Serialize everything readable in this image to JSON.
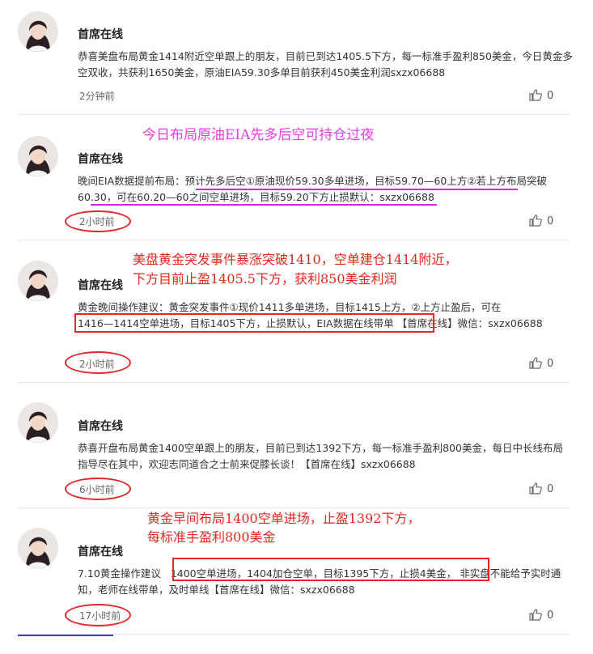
{
  "author_name": "首席在线",
  "colors": {
    "annotation_red": "#e0262a",
    "annotation_magenta": "#e040e0",
    "underline_blue": "#3b3bd6"
  },
  "posts": [
    {
      "text": "恭喜美盘布局黄金1414附近空单跟上的朋友，目前已到达1405.5下方，每一标准手盈利850美金，今日黄金多空双收，共获利1650美金，原油EIA59.30多单目前获利450美金利润sxzx06688",
      "time": "2分钟前",
      "likes": "0"
    },
    {
      "text": "晚间EIA数据提前布局：预计先多后空①原油现价59.30多单进场，目标59.70—60上方②若上方布局突破60.30，可在60.20—60之间空单进场，目标59.20下方止损默认：sxzx06688",
      "time": "2小时前",
      "likes": "0"
    },
    {
      "text_a": "黄金晚间操作建议：黄金突发事件①现价1411多单进场，目标1415上方，②上方止盈后，可在",
      "text_b_boxed": "1416—1414空单进场，目标1405下方，止损默认，EIA数据在线带单",
      "text_c": "【首席在线】微信：sxzx06688",
      "time": "2小时前",
      "likes": "0"
    },
    {
      "text": "恭喜开盘布局黄金1400空单跟上的朋友，目前已到达1392下方，每一标准手盈利800美金，每日中长线布局指导尽在其中，欢迎志同道合之士前来促膝长谈！【首席在线】sxzx06688",
      "time": "6小时前",
      "likes": "0"
    },
    {
      "text_a": "7.10黄金操作建议",
      "text_b_boxed": "1400空单进场，1404加仓空单，目标1395下方，止损4美金，",
      "text_c": "非实盘不能给予实时通知，老师在线带单，及时单线【首席在线】微信：sxzx06688",
      "time": "17小时前",
      "likes": "0"
    }
  ],
  "annotations": {
    "a1": "今日布局原油EIA先多后空可持仓过夜",
    "a2_line1": "美盘黄金突发事件暴涨突破1410，空单建仓1414附近，",
    "a2_line2": "下方目前止盈1405.5下方，获利850美金利润",
    "a3_line1": "黄金早间布局1400空单进场，止盈1392下方，",
    "a3_line2": "每标准手盈利800美金"
  }
}
